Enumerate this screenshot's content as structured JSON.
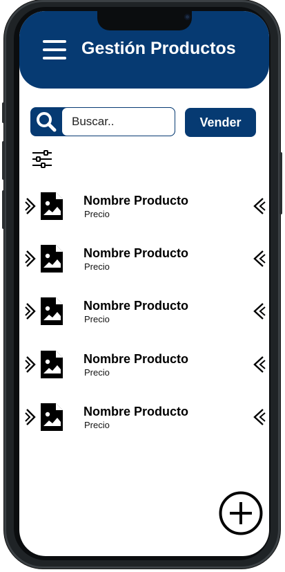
{
  "header": {
    "title": "Gestión Productos",
    "menu_icon": "hamburger-menu-icon",
    "color": "#063a72"
  },
  "search": {
    "placeholder": "Buscar..",
    "value": "",
    "icon": "search-icon"
  },
  "toolbar": {
    "sell_label": "Vender",
    "filter_icon": "sliders-filter-icon"
  },
  "products": [
    {
      "name": "Nombre Producto",
      "price_label": "Precio"
    },
    {
      "name": "Nombre Producto",
      "price_label": "Precio"
    },
    {
      "name": "Nombre Producto",
      "price_label": "Precio"
    },
    {
      "name": "Nombre Producto",
      "price_label": "Precio"
    },
    {
      "name": "Nombre Producto",
      "price_label": "Precio"
    }
  ],
  "fab": {
    "icon": "plus-circle-icon"
  },
  "colors": {
    "accent": "#063a72",
    "background": "#ffffff",
    "frame": "#1f2326"
  }
}
